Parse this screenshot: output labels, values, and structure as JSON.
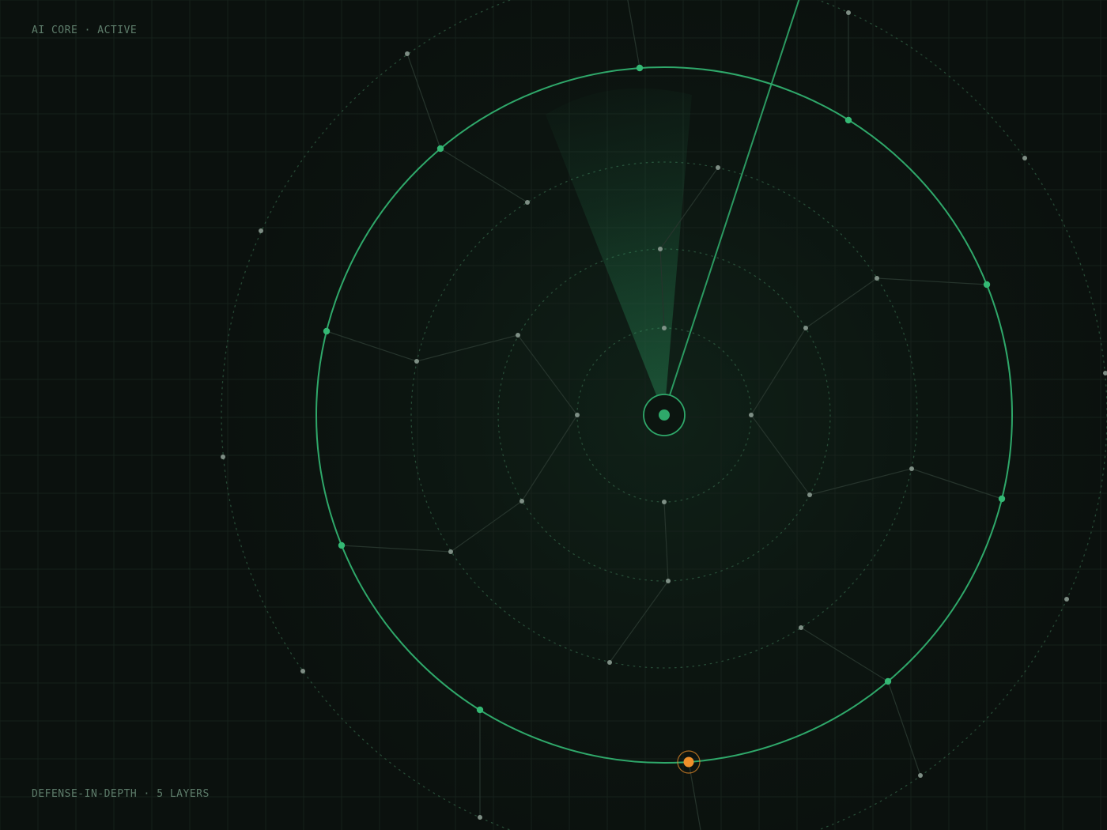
{
  "status_label": "AI CORE · ACTIVE",
  "defense_label": "DEFENSE-IN-DEPTH · 5 LAYERS",
  "colors": {
    "background": "#0b110e",
    "accent": "#2fa86a",
    "accent_bright": "#34b874",
    "alert": "#f0902a",
    "node": "#8a9a90",
    "grid": "#16211b",
    "link": "#26342c",
    "muted_text": "#5e7d6b"
  },
  "icons": {
    "core": "core-node-icon",
    "alert": "alert-node-icon"
  }
}
